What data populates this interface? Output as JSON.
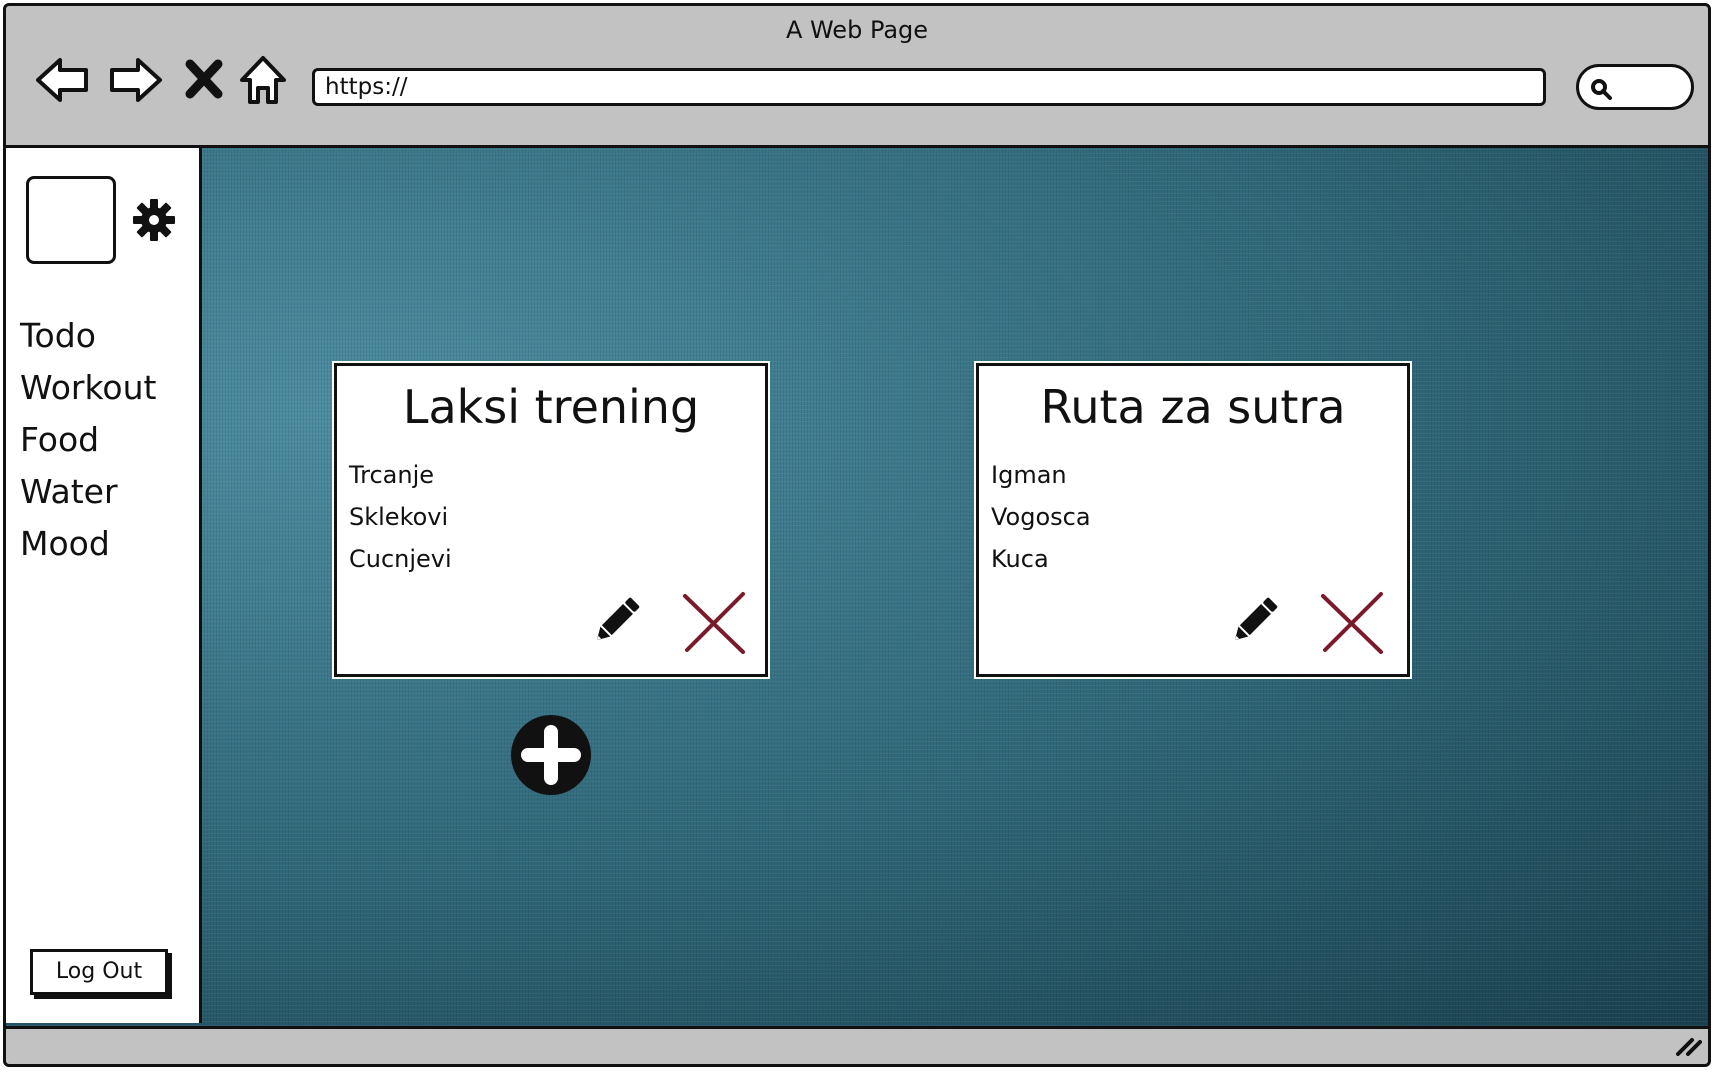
{
  "window": {
    "title": "A Web Page"
  },
  "address_bar": {
    "value": "https://"
  },
  "toolbar_icons": [
    "back-arrow-icon",
    "forward-arrow-icon",
    "stop-icon",
    "home-icon",
    "search-icon"
  ],
  "sidebar": {
    "items": [
      {
        "label": "Todo"
      },
      {
        "label": "Workout"
      },
      {
        "label": "Food"
      },
      {
        "label": "Water"
      },
      {
        "label": "Mood"
      }
    ],
    "logout_label": "Log Out"
  },
  "cards": [
    {
      "title": "Laksi trening",
      "items": [
        "Trcanje",
        "Sklekovi",
        "Cucnjevi"
      ]
    },
    {
      "title": "Ruta za sutra",
      "items": [
        "Igman",
        "Vogosca",
        "Kuca"
      ]
    }
  ],
  "colors": {
    "background": "#2f6678",
    "delete_icon": "#7a1a2a",
    "frame": "#c2c2c2"
  }
}
